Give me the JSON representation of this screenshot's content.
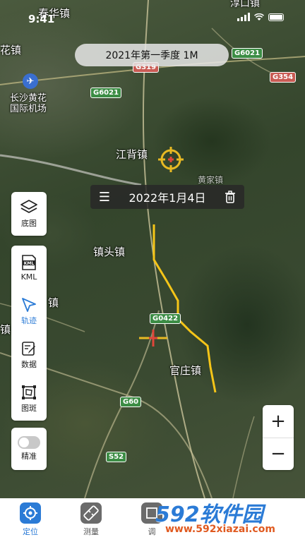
{
  "status_bar": {
    "time": "9:41"
  },
  "quarter_pill": {
    "label": "2021年第一季度 1M"
  },
  "date_bar": {
    "date": "2022年1月4日"
  },
  "places": {
    "chunhua": "春华镇",
    "huazhen": "花镇",
    "changsha_airport": "长沙黄花\n国际机场",
    "jiangbei": "江背镇",
    "zhentou": "镇头镇",
    "guanzhuang": "官庄镇",
    "zhen_left": "镇",
    "zhen_left2": "镇",
    "huangjia": "黄家镇",
    "fuqiu": "淳口镇"
  },
  "road_shields": {
    "g319": "G319",
    "g6021_top": "G6021",
    "g6021_left": "G6021",
    "g354": "G354",
    "g0422": "G0422",
    "g60": "G60",
    "s52": "S52"
  },
  "tools_panel_basemap": {
    "label": "底图",
    "icon": "layers-icon"
  },
  "tools_panel": [
    {
      "label": "KML",
      "icon": "kml-file-icon"
    },
    {
      "label": "轨迹",
      "icon": "track-arrow-icon"
    },
    {
      "label": "数据",
      "icon": "edit-data-icon"
    },
    {
      "label": "图斑",
      "icon": "polygon-spot-icon"
    }
  ],
  "precise_toggle": {
    "label": "精准",
    "state": "off"
  },
  "zoom": {
    "in": "+",
    "out": "−"
  },
  "tabs": [
    {
      "label": "定位",
      "icon": "locate-icon",
      "active": true
    },
    {
      "label": "测量",
      "icon": "measure-icon",
      "active": false
    },
    {
      "label": "调",
      "icon": "survey-icon",
      "active": false
    }
  ],
  "watermark": {
    "brand": "592软件园",
    "url": "www.592xiazai.com"
  },
  "colors": {
    "accent": "#2b7bd6",
    "track": "#f5c518",
    "crosshair": "#e8b923",
    "marker": "#e0463a"
  }
}
